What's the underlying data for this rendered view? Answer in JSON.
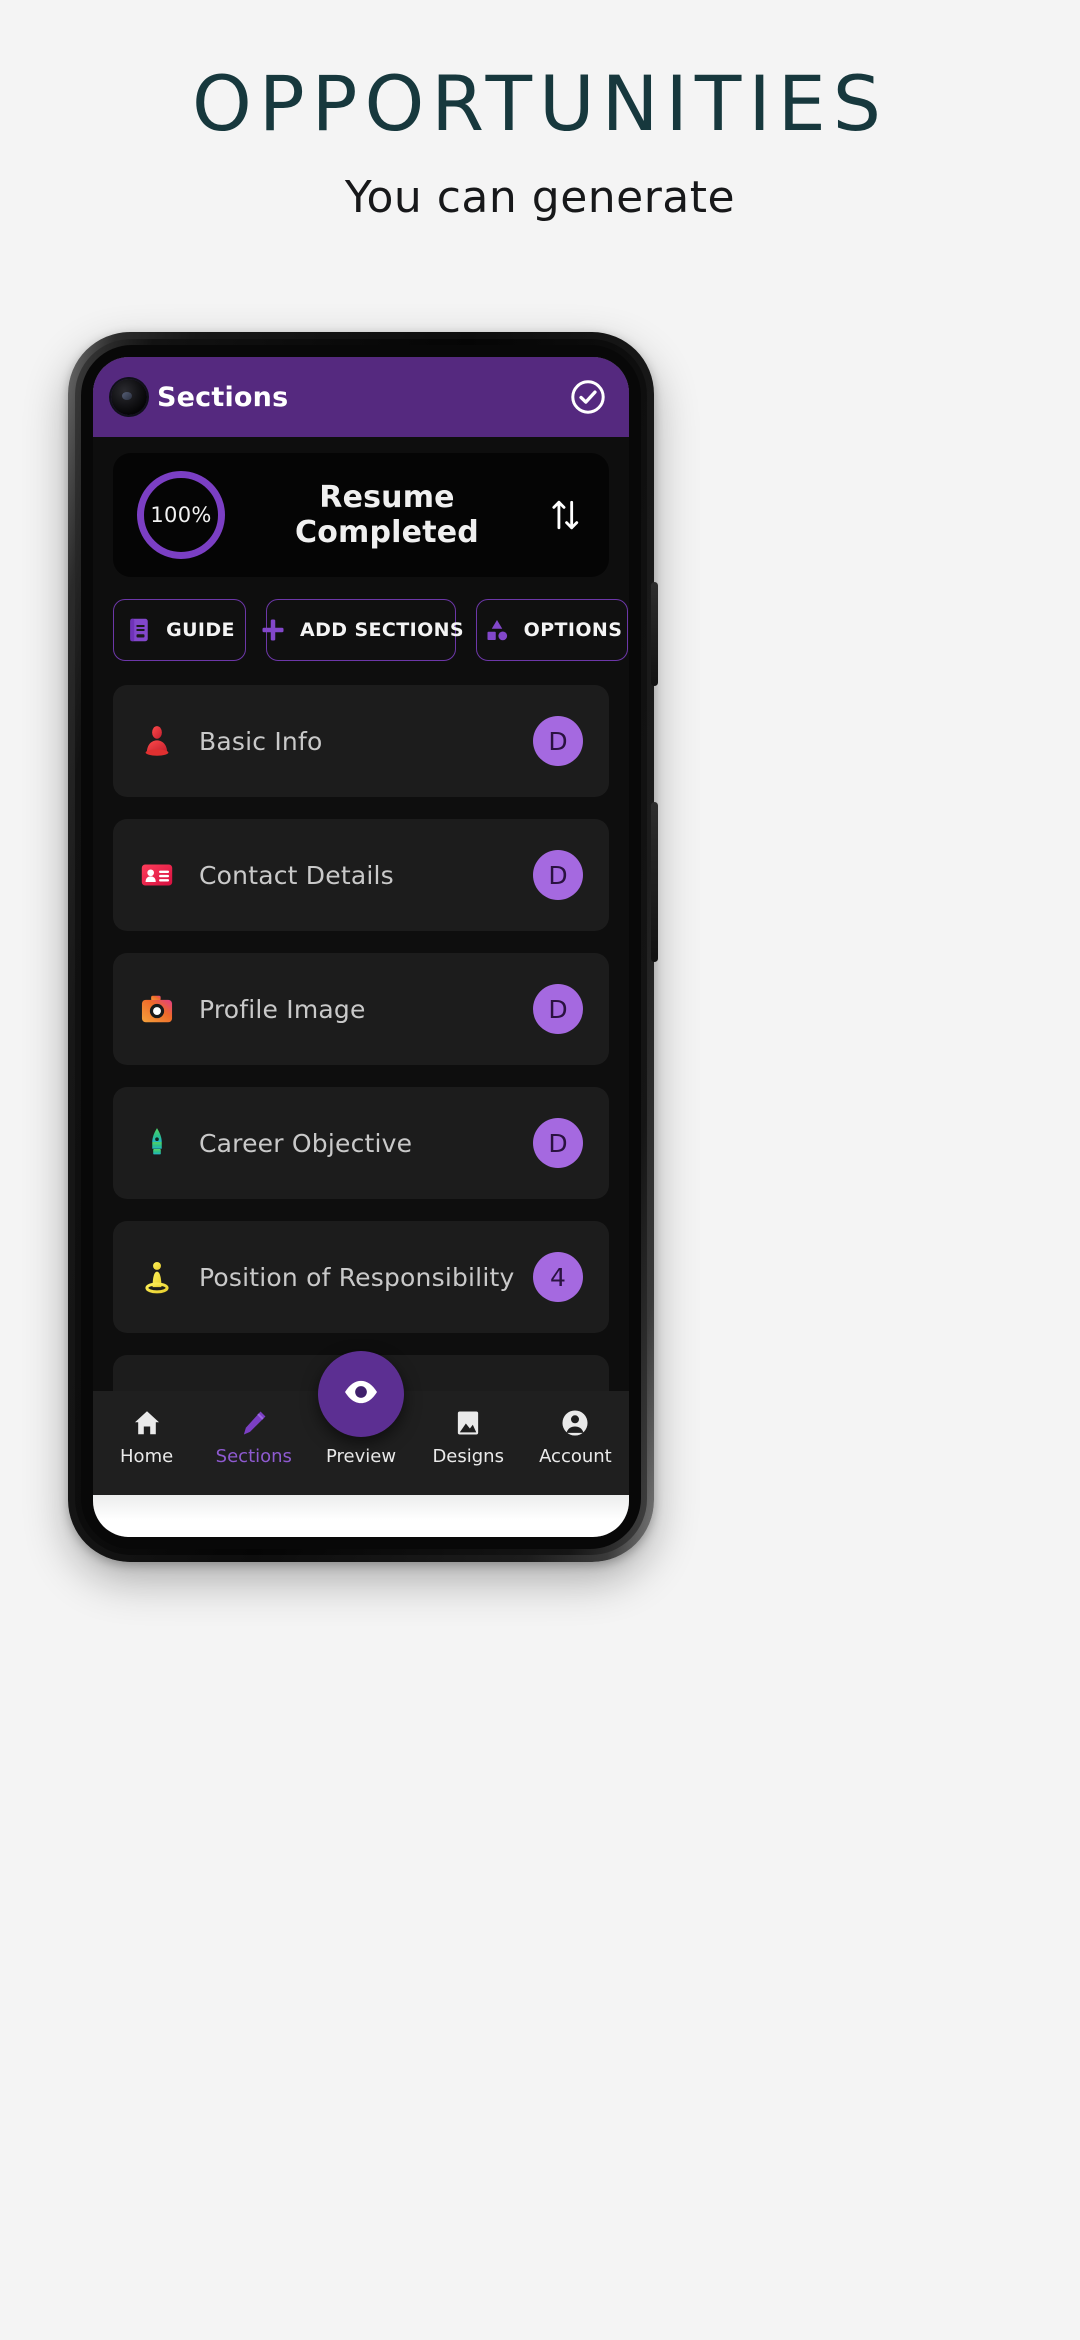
{
  "promo": {
    "title": "OPPORTUNITIES",
    "subtitle": "You can generate",
    "title_color": "#17383d"
  },
  "theme": {
    "accent_purple": "#55297f",
    "badge_purple": "#a569e0",
    "ring_purple": "#7b3fc4",
    "fab_purple": "#5c2f92",
    "card_bg": "#1c1c1c",
    "app_bg": "#0e0e0e"
  },
  "appbar": {
    "title": "Sections",
    "check_icon": "check-circle-icon",
    "punchhole_icon": "front-camera-icon"
  },
  "progress": {
    "percent_label": "100%",
    "percent_value": 100,
    "title": "Resume Completed",
    "sort_icon": "sort-arrows-icon"
  },
  "actions": [
    {
      "label": "GUIDE",
      "icon": "book-icon"
    },
    {
      "label": "ADD SECTIONS",
      "icon": "plus-icon"
    },
    {
      "label": "OPTIONS",
      "icon": "shapes-icon"
    }
  ],
  "sections": [
    {
      "label": "Basic Info",
      "icon": "person-red-icon",
      "badge": "D"
    },
    {
      "label": "Contact Details",
      "icon": "id-card-icon",
      "badge": "D"
    },
    {
      "label": "Profile Image",
      "icon": "camera-icon",
      "badge": "D"
    },
    {
      "label": "Career Objective",
      "icon": "pen-nib-icon",
      "badge": "D"
    },
    {
      "label": "Position of Responsibility",
      "icon": "podium-icon",
      "badge": "4"
    }
  ],
  "bottom_nav": {
    "items": [
      {
        "label": "Home",
        "icon": "home-icon",
        "active": false
      },
      {
        "label": "Sections",
        "icon": "pencil-icon",
        "active": true
      },
      {
        "label": "Preview",
        "icon": "eye-icon",
        "active": false
      },
      {
        "label": "Designs",
        "icon": "image-icon",
        "active": false
      },
      {
        "label": "Account",
        "icon": "account-icon",
        "active": false
      }
    ]
  }
}
